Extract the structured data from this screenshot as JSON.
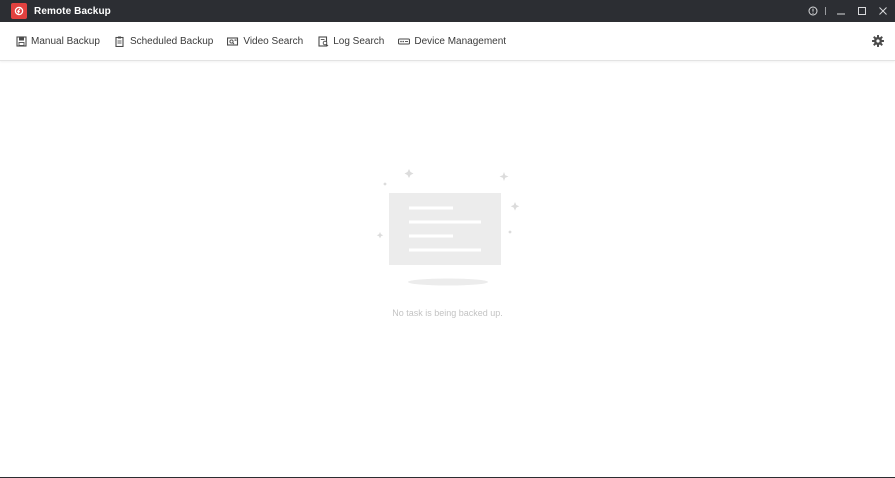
{
  "window": {
    "title": "Remote Backup",
    "accent_color": "#e2413f",
    "titlebar_color": "#2c2e33",
    "controls": {
      "help_icon": "info-circle-icon",
      "minimize_icon": "minimize-icon",
      "maximize_icon": "maximize-icon",
      "close_icon": "close-icon"
    }
  },
  "toolbar": {
    "items": [
      {
        "label": "Manual Backup",
        "icon": "floppy-disk-icon"
      },
      {
        "label": "Scheduled Backup",
        "icon": "clipboard-schedule-icon"
      },
      {
        "label": "Video Search",
        "icon": "video-search-icon"
      },
      {
        "label": "Log Search",
        "icon": "log-search-icon"
      },
      {
        "label": "Device Management",
        "icon": "device-icon"
      }
    ],
    "settings_icon": "gear-icon"
  },
  "main": {
    "empty_message": "No task is being backed up.",
    "empty_illustration_icon": "empty-document-icon"
  }
}
